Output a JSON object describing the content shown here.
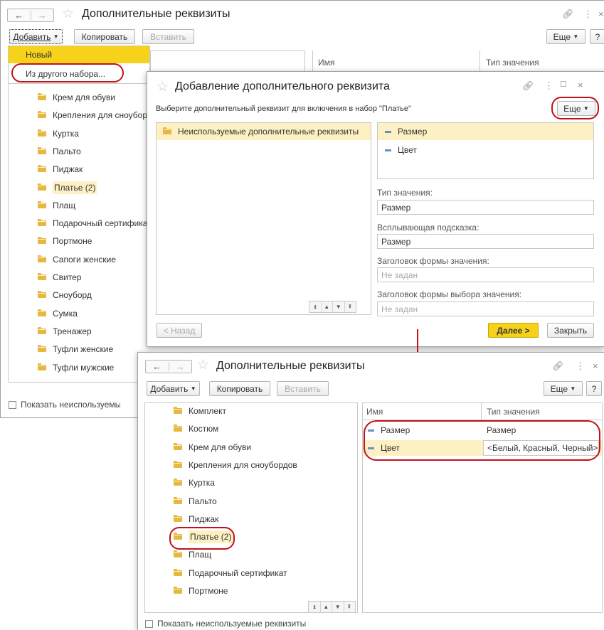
{
  "colors": {
    "accent_yellow": "#f7d21b",
    "highlight_row": "#fdf1c4",
    "red_annotation": "#c0121b",
    "folder": "#e7b841"
  },
  "back_window": {
    "title": "Дополнительные реквизиты",
    "toolbar": {
      "add": "Добавить",
      "copy": "Копировать",
      "paste": "Вставить",
      "more": "Еще",
      "help": "?"
    },
    "add_menu": {
      "items": [
        "Новый",
        "Из другого набора..."
      ]
    },
    "columns": {
      "name": "Имя",
      "value_type": "Тип значения"
    },
    "tree_items": [
      "Крем для обуви",
      "Крепления для сноубордов",
      "Куртка",
      "Пальто",
      "Пиджак",
      "Платье (2)",
      "Плащ",
      "Подарочный сертификат",
      "Портмоне",
      "Сапоги женские",
      "Свитер",
      "Сноуборд",
      "Сумка",
      "Тренажер",
      "Туфли женские",
      "Туфли мужские"
    ],
    "show_unused": "Показать неиспользуемые реквизиты"
  },
  "dialog": {
    "title": "Добавление дополнительного реквизита",
    "instruction": "Выберите дополнительный реквизит для включения в набор \"Платье\"",
    "more": "Еще",
    "left_item": "Неиспользуемые дополнительные реквизиты",
    "right_items": [
      "Размер",
      "Цвет"
    ],
    "value_type_label": "Тип значения:",
    "value_type_value": "Размер",
    "tooltip_label": "Всплывающая подсказка:",
    "tooltip_value": "Размер",
    "form_header_label": "Заголовок формы значения:",
    "form_header_placeholder": "Не задан",
    "choice_header_label": "Заголовок формы выбора значения:",
    "choice_header_placeholder": "Не задан",
    "back": "< Назад",
    "next": "Далее >",
    "close": "Закрыть"
  },
  "front_window": {
    "title": "Дополнительные реквизиты",
    "toolbar": {
      "add": "Добавить",
      "copy": "Копировать",
      "paste": "Вставить",
      "more": "Еще",
      "help": "?"
    },
    "tree_items": [
      "Комплект",
      "Костюм",
      "Крем для обуви",
      "Крепления для сноубордов",
      "Куртка",
      "Пальто",
      "Пиджак",
      "Платье (2)",
      "Плащ",
      "Подарочный сертификат",
      "Портмоне"
    ],
    "columns": {
      "name": "Имя",
      "value_type": "Тип значения"
    },
    "rows": [
      {
        "name": "Размер",
        "value_type": "Размер"
      },
      {
        "name": "Цвет",
        "value_type": "<Белый, Красный, Черный>"
      }
    ],
    "show_unused": "Показать неиспользуемые реквизиты"
  },
  "icons": {
    "link": "link-icon",
    "menu": "more-vertical-icon",
    "maximize": "maximize-icon",
    "close": "close-icon",
    "star": "star-icon",
    "folder": "folder-icon"
  }
}
